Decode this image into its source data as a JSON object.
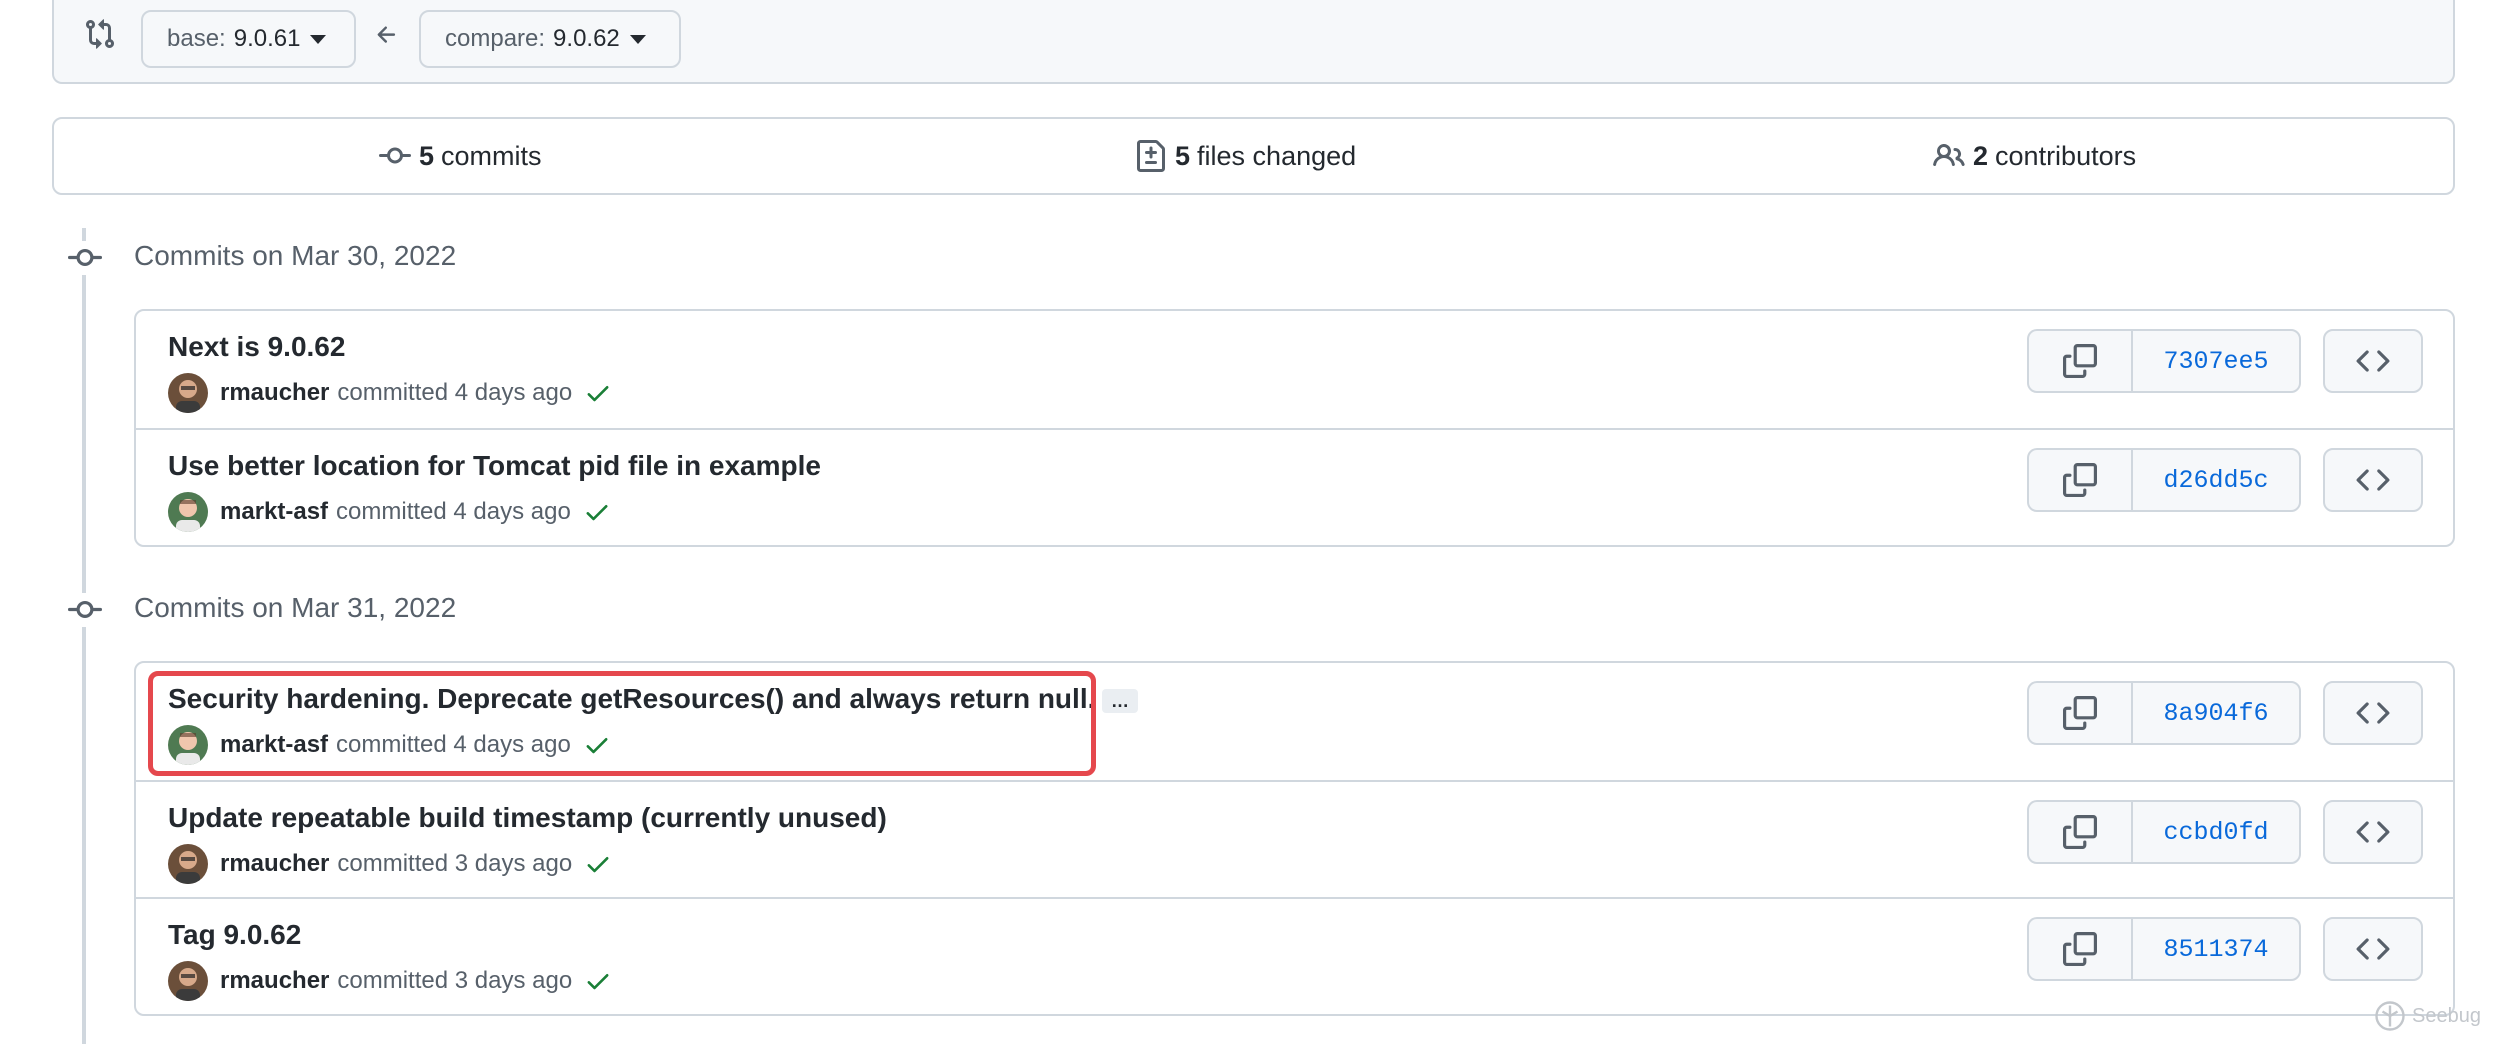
{
  "compare": {
    "base_prefix": "base:",
    "base_value": "9.0.61",
    "compare_prefix": "compare:",
    "compare_value": "9.0.62",
    "icons": [
      "git-compare-icon",
      "arrow-left-icon",
      "caret-down-icon"
    ]
  },
  "summary": {
    "commits_count": "5",
    "commits_label": "commits",
    "files_count": "5",
    "files_label": "files changed",
    "contributors_count": "2",
    "contributors_label": "contributors"
  },
  "groups": [
    {
      "title": "Commits on Mar 30, 2022",
      "commits": [
        {
          "message": "Next is 9.0.62",
          "author": "rmaucher",
          "time": "committed 4 days ago",
          "sha": "7307ee5"
        },
        {
          "message": "Use better location for Tomcat pid file in example",
          "author": "markt-asf",
          "time": "committed 4 days ago",
          "sha": "d26dd5c"
        }
      ]
    },
    {
      "title": "Commits on Mar 31, 2022",
      "commits": [
        {
          "message": "Security hardening. Deprecate getResources() and always return null.",
          "ellipsis": "…",
          "author": "markt-asf",
          "time": "committed 4 days ago",
          "sha": "8a904f6",
          "highlighted": true
        },
        {
          "message": "Update repeatable build timestamp (currently unused)",
          "author": "rmaucher",
          "time": "committed 3 days ago",
          "sha": "ccbd0fd"
        },
        {
          "message": "Tag 9.0.62",
          "author": "rmaucher",
          "time": "committed 3 days ago",
          "sha": "8511374"
        }
      ]
    }
  ],
  "watermark": "Seebug",
  "colors": {
    "link": "#0969da",
    "border": "#d0d7de",
    "muted": "#57606a",
    "success": "#1a7f37",
    "highlight": "#e5484d"
  }
}
